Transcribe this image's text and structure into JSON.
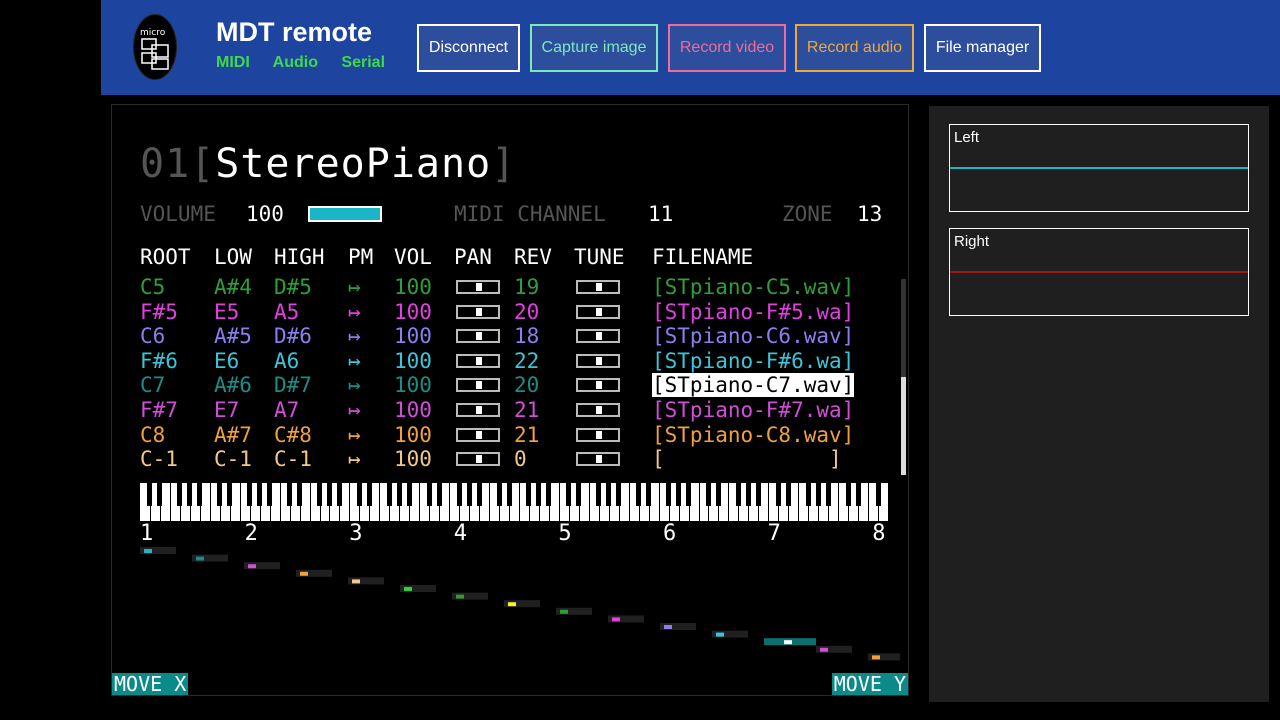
{
  "header": {
    "app_title": "MDT remote",
    "logo_text": "micro",
    "links": [
      "MIDI",
      "Audio",
      "Serial"
    ],
    "buttons": {
      "disconnect": "Disconnect",
      "capture_image": "Capture image",
      "record_video": "Record video",
      "record_audio": "Record audio",
      "file_manager": "File manager"
    }
  },
  "device": {
    "preset_number": "01",
    "preset_name": "StereoPiano",
    "volume_label": "VOLUME",
    "volume_value": "100",
    "midi_channel_label": "MIDI CHANNEL",
    "midi_channel_value": "11",
    "zone_label": "ZONE",
    "zone_value": "13",
    "columns": [
      "ROOT",
      "LOW",
      "HIGH",
      "PM",
      "VOL",
      "PAN",
      "REV",
      "TUNE",
      "FILENAME"
    ],
    "rows": [
      {
        "root": "C5",
        "low": "A#4",
        "high": "D#5",
        "pm": "↦",
        "vol": "100",
        "rev": "19",
        "file": "[STpiano-C5.wav]",
        "color": "#2e9e3a"
      },
      {
        "root": "F#5",
        "low": "E5",
        "high": "A5",
        "pm": "↦",
        "vol": "100",
        "rev": "20",
        "file": "[STpiano-F#5.wa]",
        "color": "#e040e0"
      },
      {
        "root": "C6",
        "low": "A#5",
        "high": "D#6",
        "pm": "↦",
        "vol": "100",
        "rev": "18",
        "file": "[STpiano-C6.wav]",
        "color": "#8a7ef0"
      },
      {
        "root": "F#6",
        "low": "E6",
        "high": "A6",
        "pm": "↦",
        "vol": "100",
        "rev": "22",
        "file": "[STpiano-F#6.wa]",
        "color": "#3cc4d8"
      },
      {
        "root": "C7",
        "low": "A#6",
        "high": "D#7",
        "pm": "↦",
        "vol": "100",
        "rev": "20",
        "file": "[STpiano-C7.wav]",
        "color": "#1e8c86"
      },
      {
        "root": "F#7",
        "low": "E7",
        "high": "A7",
        "pm": "↦",
        "vol": "100",
        "rev": "21",
        "file": "[STpiano-F#7.wa]",
        "color": "#d04ed8"
      },
      {
        "root": "C8",
        "low": "A#7",
        "high": "C#8",
        "pm": "↦",
        "vol": "100",
        "rev": "21",
        "file": "[STpiano-C8.wav]",
        "color": "#f0a040"
      },
      {
        "root": "C-1",
        "low": "C-1",
        "high": "C-1",
        "pm": "↦",
        "vol": "100",
        "rev": "0",
        "file": "[             ]",
        "color": "#f2c88a"
      }
    ],
    "selected_row": 4,
    "zone_numbers": [
      "1",
      "2",
      "3",
      "4",
      "5",
      "6",
      "7",
      "8"
    ],
    "move_x": "MOVE X",
    "move_y": "MOVE Y"
  },
  "meters": {
    "left_label": "Left",
    "right_label": "Right",
    "left_color": "#1fb5c2",
    "right_color": "#a01818"
  }
}
